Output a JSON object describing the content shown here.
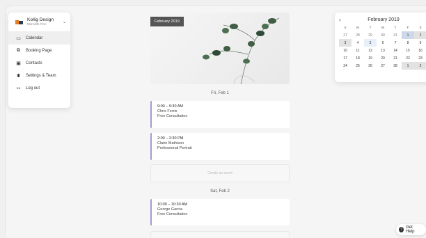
{
  "menu": {
    "brand_name": "Kollig Design",
    "user_name": "Meredith Finn",
    "items": [
      {
        "label": "Calendar",
        "icon": "calendar-icon"
      },
      {
        "label": "Booking Page",
        "icon": "booking-page-icon"
      },
      {
        "label": "Contacts",
        "icon": "contacts-icon"
      },
      {
        "label": "Settings & Team",
        "icon": "gear-icon"
      },
      {
        "label": "Log out",
        "icon": "logout-icon"
      }
    ]
  },
  "hero": {
    "month_label": "February 2019"
  },
  "days": [
    {
      "date": "Fri, Feb 1",
      "events": [
        {
          "time": "9:00 – 9:30 AM",
          "name": "Chris Ferris",
          "type": "Free Consultation"
        },
        {
          "time": "2:00 – 2:30 PM",
          "name": "Claire Mathison",
          "type": "Professional Portrait"
        }
      ],
      "create_label": "Create an event"
    },
    {
      "date": "Sat, Feb 2",
      "events": [
        {
          "time": "10:00 – 10:30 AM",
          "name": "George Garcia",
          "type": "Free Consultation"
        }
      ]
    }
  ],
  "calendar": {
    "title": "February 2019",
    "weekdays": [
      "S",
      "M",
      "T",
      "W",
      "T",
      "F",
      "S"
    ],
    "weeks": [
      [
        "27",
        "28",
        "29",
        "30",
        "31",
        "1",
        "2"
      ],
      [
        "3",
        "4",
        "5",
        "6",
        "7",
        "8",
        "9"
      ],
      [
        "10",
        "11",
        "12",
        "13",
        "14",
        "15",
        "16"
      ],
      [
        "17",
        "18",
        "19",
        "20",
        "21",
        "22",
        "23"
      ],
      [
        "24",
        "25",
        "26",
        "27",
        "28",
        "1",
        "2"
      ]
    ]
  },
  "help": {
    "label": "Get Help"
  },
  "colors": {
    "event_accent": "#a59ad0",
    "selected_day": "#cdd8ea"
  }
}
